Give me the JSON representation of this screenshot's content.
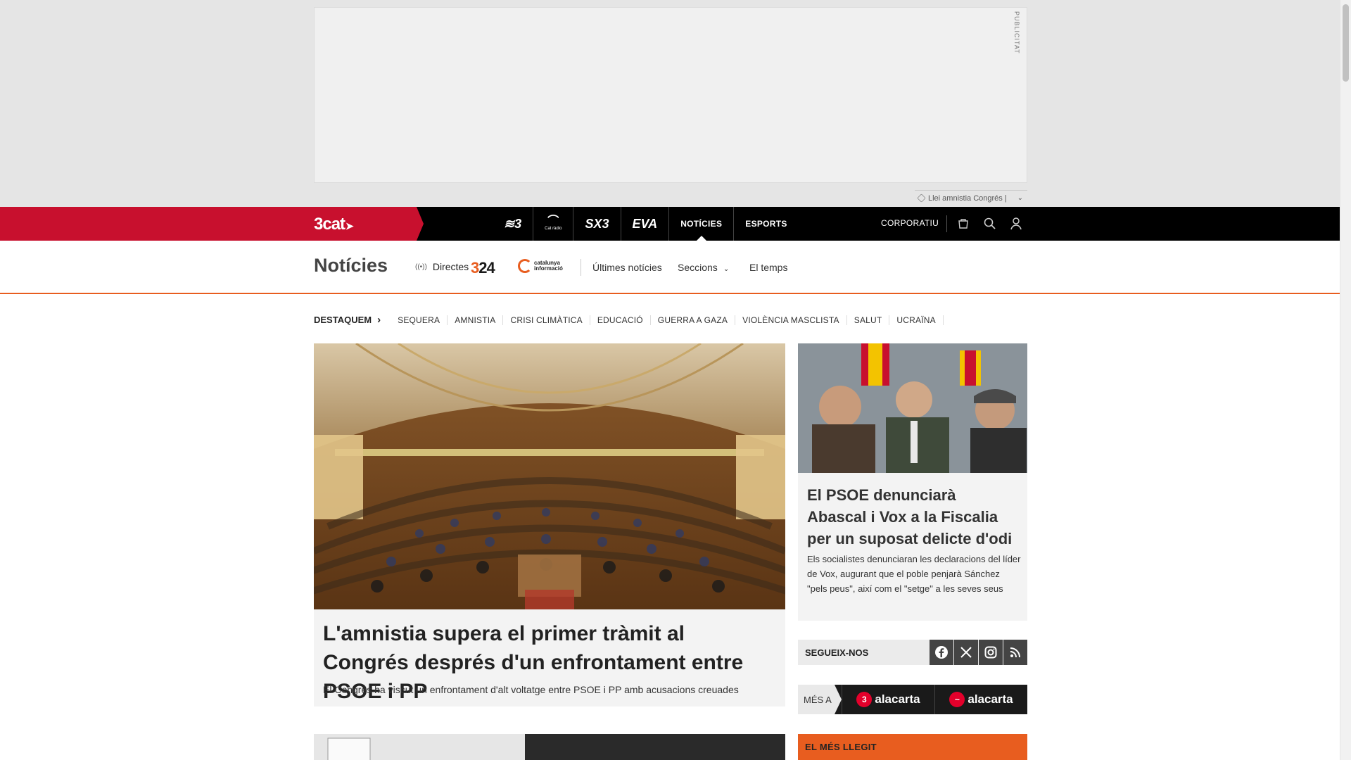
{
  "ad": {
    "label": "PUBLICITAT",
    "tag_text": "Llei amnistia Congrés |"
  },
  "topnav": {
    "brand": "3cat",
    "channels": [
      {
        "label": "3",
        "icon": "tv3-logo"
      },
      {
        "label": "Cat ràdio",
        "icon": "catradio-logo"
      },
      {
        "label": "SX3",
        "icon": "sx3-logo"
      },
      {
        "label": "EVA",
        "icon": "eva-logo"
      },
      {
        "label": "NOTÍCIES",
        "icon": ""
      },
      {
        "label": "ESPORTS",
        "icon": ""
      }
    ],
    "corporatiu": "CORPORATIU",
    "icons": [
      "shop-icon",
      "search-icon",
      "user-icon"
    ]
  },
  "section": {
    "title": "Notícies",
    "directes": "Directes",
    "logo_324": "324",
    "logo_ci": "catalunya informació",
    "links": {
      "ultimes": "Últimes notícies",
      "seccions": "Seccions",
      "temps": "El temps"
    }
  },
  "destaquem": {
    "label": "DESTAQUEM",
    "tags": [
      "SEQUERA",
      "AMNISTIA",
      "CRISI CLIMÀTICA",
      "EDUCACIÓ",
      "GUERRA A GAZA",
      "VIOLÈNCIA MASCLISTA",
      "SALUT",
      "UCRAÏNA"
    ]
  },
  "main_story": {
    "title": "L'amnistia supera el primer tràmit al Congrés després d'un enfrontament entre PSOE i PP",
    "subtitle": "El Congrés ha viscut un enfrontament d'alt voltatge entre PSOE i PP amb acusacions creuades"
  },
  "side_story": {
    "title": "El PSOE denunciarà Abascal i Vox a la Fiscalia per un suposat delicte d'odi",
    "subtitle": "Els socialistes denunciaran les declaracions del líder de Vox, augurant que el poble penjarà Sánchez \"pels peus\", així com el \"setge\" a les seves seus"
  },
  "social": {
    "label": "SEGUEIX-NOS",
    "networks": [
      "facebook-icon",
      "x-icon",
      "instagram-icon",
      "rss-icon"
    ]
  },
  "alacarta": {
    "mes": "MÉS A",
    "items": [
      {
        "badge": "3",
        "label": "alacarta"
      },
      {
        "badge": "~",
        "label": "alacarta"
      }
    ]
  },
  "mesllegit": {
    "label": "EL MÉS LLEGIT"
  }
}
